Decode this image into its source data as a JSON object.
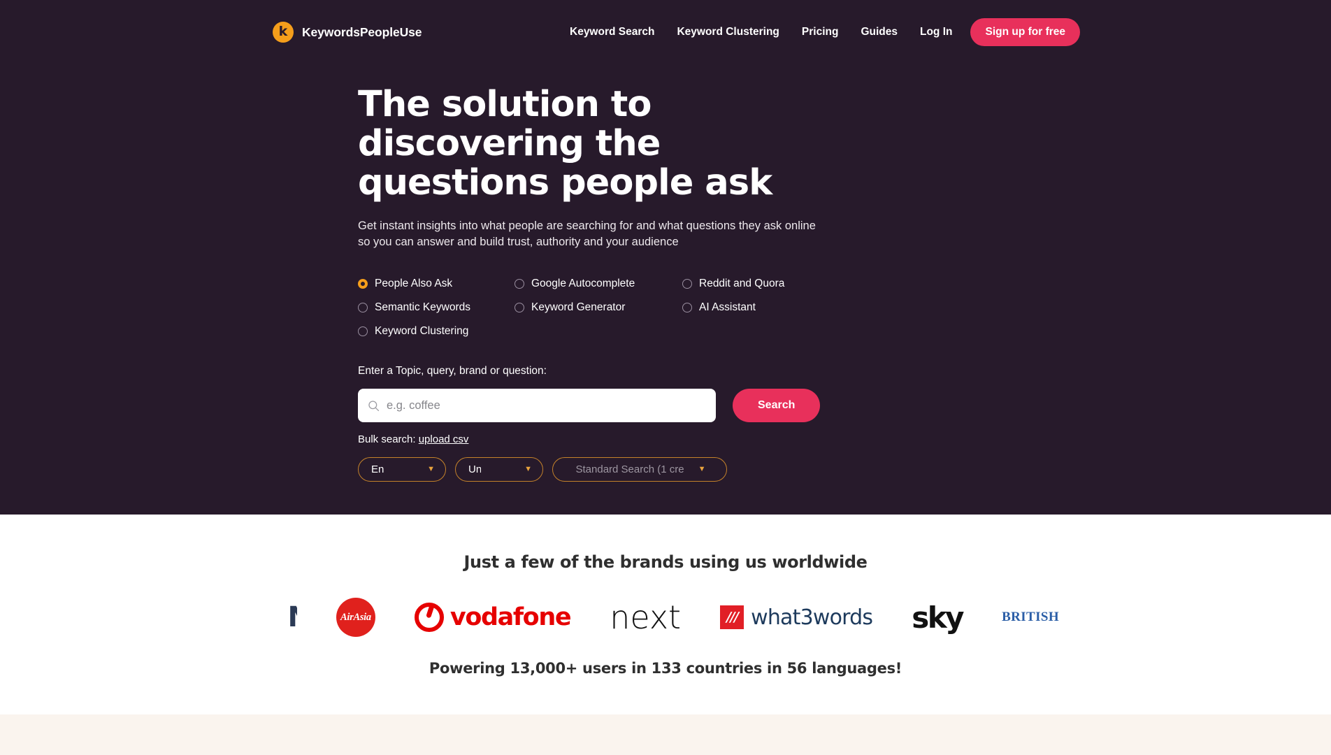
{
  "brand": {
    "name": "KeywordsPeopleUse",
    "mark_glyph": "k",
    "mark_color": "#F59E1B"
  },
  "nav": {
    "links": [
      {
        "label": "Keyword Search"
      },
      {
        "label": "Keyword Clustering"
      },
      {
        "label": "Pricing"
      },
      {
        "label": "Guides"
      },
      {
        "label": "Log In"
      }
    ],
    "cta_label": "Sign up for free",
    "cta_color": "#E8305B"
  },
  "hero": {
    "headline": "The solution to discovering the questions people ask",
    "subhead": "Get instant insights into what people are searching for and what questions they ask online so you can answer and build trust, authority and your audience",
    "background": "#271A2B"
  },
  "options": {
    "selected": "People Also Ask",
    "accent": "#F59E1B",
    "items": [
      {
        "label": "People Also Ask",
        "selected": true
      },
      {
        "label": "Google Autocomplete",
        "selected": false
      },
      {
        "label": "Reddit and Quora",
        "selected": false
      },
      {
        "label": "Semantic Keywords",
        "selected": false
      },
      {
        "label": "Keyword Generator",
        "selected": false
      },
      {
        "label": "AI Assistant",
        "selected": false
      },
      {
        "label": "Keyword Clustering",
        "selected": false
      }
    ]
  },
  "search": {
    "label": "Enter a Topic, query, brand or question:",
    "placeholder": "e.g. coffee",
    "value": "",
    "button_label": "Search",
    "icon": "search-icon"
  },
  "bulk": {
    "prefix": "Bulk search:",
    "link_label": "upload csv"
  },
  "selects": {
    "language": {
      "value": "English",
      "caret": "chevron-down-icon"
    },
    "country": {
      "value": "United States",
      "caret": "chevron-down-icon"
    },
    "search_type": {
      "value": "Standard Search (1 cre",
      "caret": "chevron-down-icon"
    }
  },
  "brands_section": {
    "title": "Just a few of the brands using us worldwide",
    "logos": [
      {
        "name": "partial-logo",
        "text": "N"
      },
      {
        "name": "airasia-logo",
        "text": "AirAsia"
      },
      {
        "name": "vodafone-logo",
        "text": "vodafone"
      },
      {
        "name": "next-logo",
        "text": "next"
      },
      {
        "name": "what3words-logo",
        "mark": "///",
        "text": "what3words"
      },
      {
        "name": "sky-logo",
        "text": "sky"
      },
      {
        "name": "british-logo",
        "text": "BRITISH"
      }
    ],
    "powering": "Powering 13,000+ users in 133 countries in 56 languages!"
  }
}
